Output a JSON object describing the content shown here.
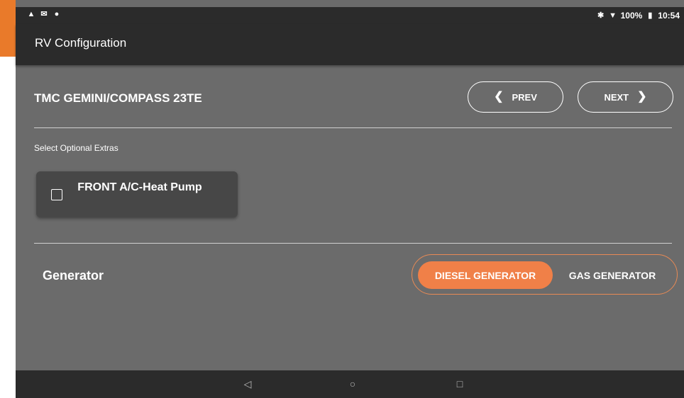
{
  "status_bar": {
    "left_icons": [
      "warning-icon",
      "gmail-icon",
      "circle-icon"
    ],
    "battery": "100%",
    "time": "10:54"
  },
  "app_bar": {
    "title": "RV Configuration"
  },
  "model": {
    "title": "TMC GEMINI/COMPASS 23TE"
  },
  "nav": {
    "prev_label": "PREV",
    "next_label": "NEXT"
  },
  "extras": {
    "section_label": "Select Optional Extras",
    "items": [
      {
        "label": "FRONT A/C-Heat Pump",
        "checked": false
      }
    ]
  },
  "generator": {
    "label": "Generator",
    "options": [
      "DIESEL GENERATOR",
      "GAS GENERATOR"
    ],
    "selected": "DIESEL GENERATOR"
  },
  "colors": {
    "accent": "#f08048",
    "toolbar": "#2b2b2b",
    "background": "#6b6b6b",
    "card": "#474747"
  }
}
